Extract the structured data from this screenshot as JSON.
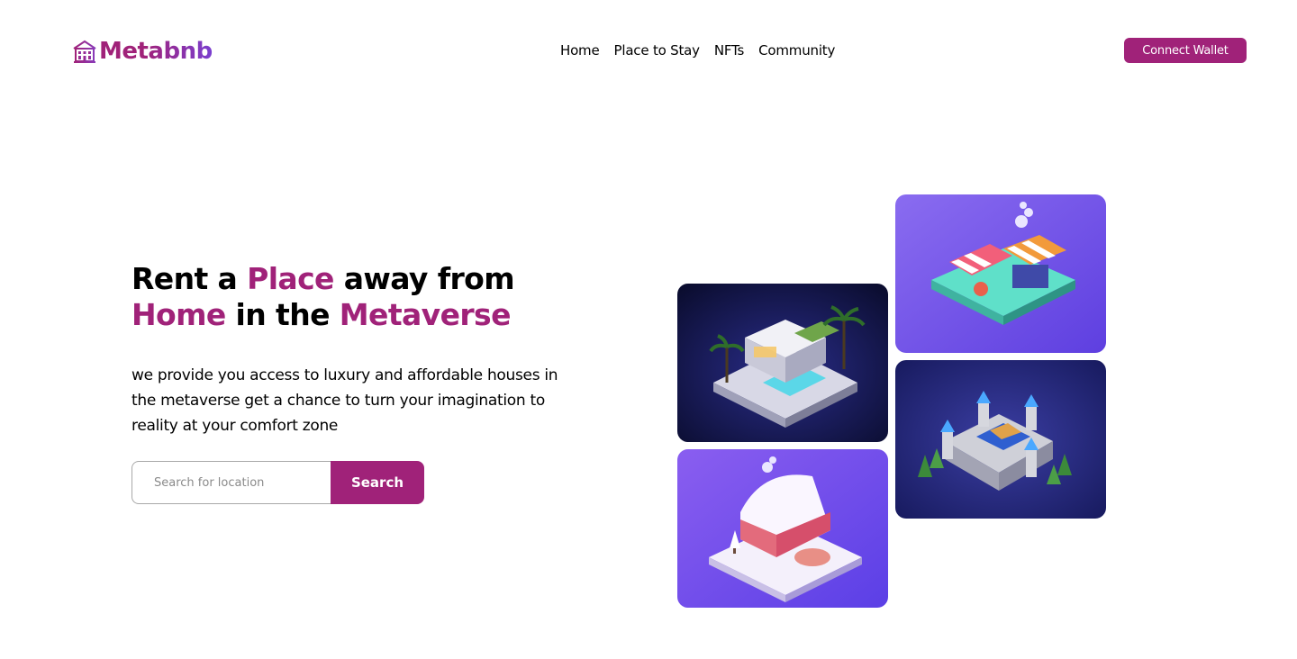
{
  "header": {
    "logo_text": "Metabnb",
    "nav": [
      "Home",
      "Place to Stay",
      "NFTs",
      "Community"
    ],
    "connect_label": "Connect Wallet"
  },
  "hero": {
    "headline": {
      "part1": "Rent a ",
      "accent1": "Place",
      "part2": " away from",
      "accent2": "Home",
      "part3": " in the ",
      "accent3": "Metaverse"
    },
    "subtext": "we provide you access to luxury and affordable houses in the metaverse get a chance to turn your imagination to reality at your comfort zone",
    "search": {
      "placeholder": "Search for location",
      "button_label": "Search"
    }
  },
  "gallery": [
    {
      "name": "villa-image",
      "icon": "isometric-villa"
    },
    {
      "name": "market-image",
      "icon": "isometric-market"
    },
    {
      "name": "cottage-image",
      "icon": "isometric-snow-cottage"
    },
    {
      "name": "castle-image",
      "icon": "isometric-castle"
    }
  ],
  "colors": {
    "brand": "#a02279",
    "brand_gradient_end": "#7a3fd0"
  }
}
